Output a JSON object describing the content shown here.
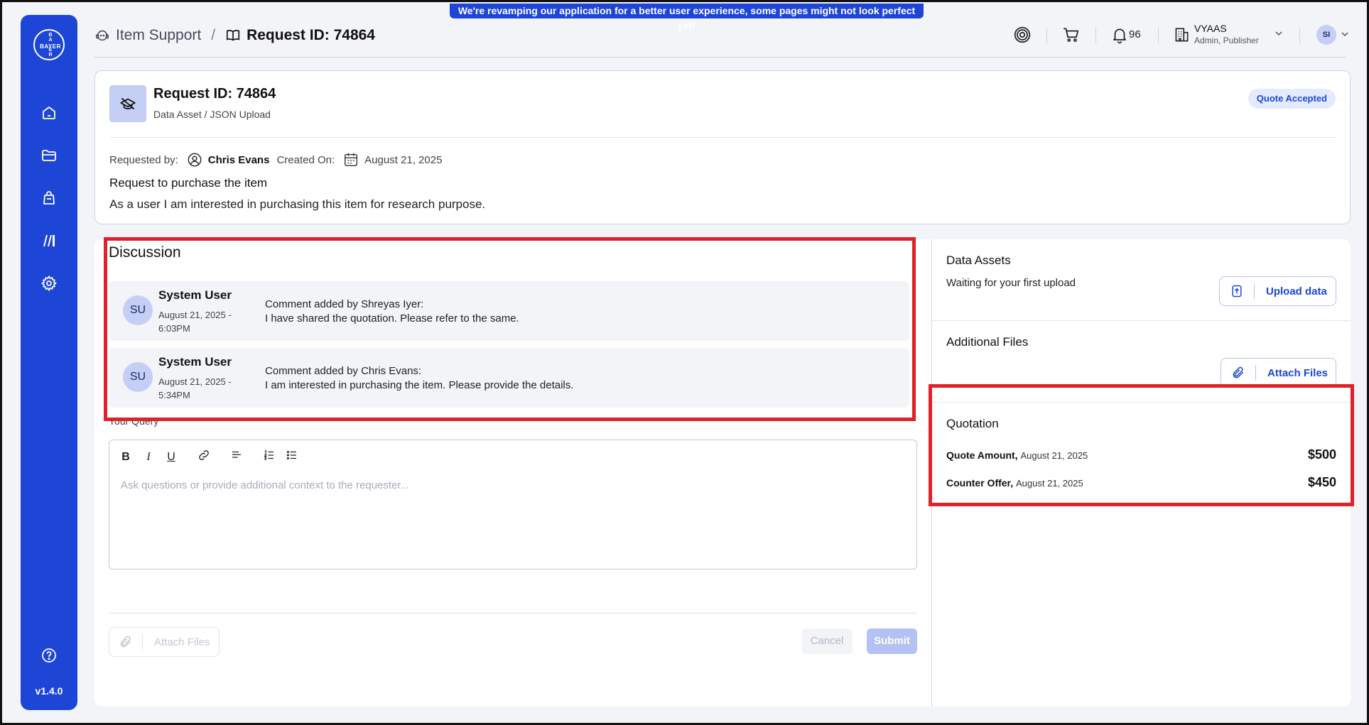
{
  "banner": "We're revamping our application for a better user experience, some pages might not look perfect yet!",
  "sidebar": {
    "logo_vertical": [
      "B",
      "A",
      "Y",
      "E",
      "R"
    ],
    "logo_horizontal": "BAYER",
    "items": [
      {
        "icon": "home-icon"
      },
      {
        "icon": "folder-icon"
      },
      {
        "icon": "bag-icon"
      },
      {
        "icon": "catalog-icon"
      },
      {
        "icon": "gear-icon"
      }
    ],
    "help_icon": "help-icon",
    "version": "v1.4.0"
  },
  "header": {
    "breadcrumb_root": "Item Support",
    "breadcrumb_separator": "/",
    "breadcrumb_current": "Request ID: 74864",
    "notification_count": "96",
    "org_name": "VYAAS",
    "org_role": "Admin, Publisher",
    "avatar_initials": "SI"
  },
  "request": {
    "title": "Request ID: 74864",
    "subtitle": "Data Asset / JSON Upload",
    "status": "Quote Accepted",
    "requested_by_label": "Requested by:",
    "requested_by": "Chris Evans",
    "created_on_label": "Created On:",
    "created_on": "August 21, 2025",
    "heading": "Request to purchase the item",
    "description": "As a user I am interested in purchasing this item for research purpose."
  },
  "discussion": {
    "title": "Discussion",
    "comments": [
      {
        "initials": "SU",
        "user": "System User",
        "date_line1": "August 21, 2025 -",
        "date_line2": "6:03PM",
        "by": "Comment added by Shreyas Iyer:",
        "message": "I have shared the quotation. Please refer to the same."
      },
      {
        "initials": "SU",
        "user": "System User",
        "date_line1": "August 21, 2025 -",
        "date_line2": "5:34PM",
        "by": "Comment added by Chris Evans:",
        "message": "I am interested in purchasing the item. Please provide the details."
      }
    ],
    "query_label": "Your Query",
    "editor_placeholder": "Ask questions or provide additional context to the requester...",
    "toolbar": {
      "bold": "B",
      "italic": "I",
      "underline": "U"
    },
    "attach_label": "Attach Files",
    "cancel_label": "Cancel",
    "submit_label": "Submit"
  },
  "right": {
    "data_assets_title": "Data Assets",
    "data_assets_text": "Waiting for your first upload",
    "upload_label": "Upload data",
    "additional_files_title": "Additional Files",
    "attach_label": "Attach Files",
    "quotation_title": "Quotation",
    "quote_amount_label": "Quote Amount,",
    "quote_amount_date": "August 21, 2025",
    "quote_amount_value": "$500",
    "counter_offer_label": "Counter Offer,",
    "counter_offer_date": "August 21, 2025",
    "counter_offer_value": "$450"
  },
  "colors": {
    "brand": "#1e46d6",
    "highlight": "#e0202a"
  }
}
